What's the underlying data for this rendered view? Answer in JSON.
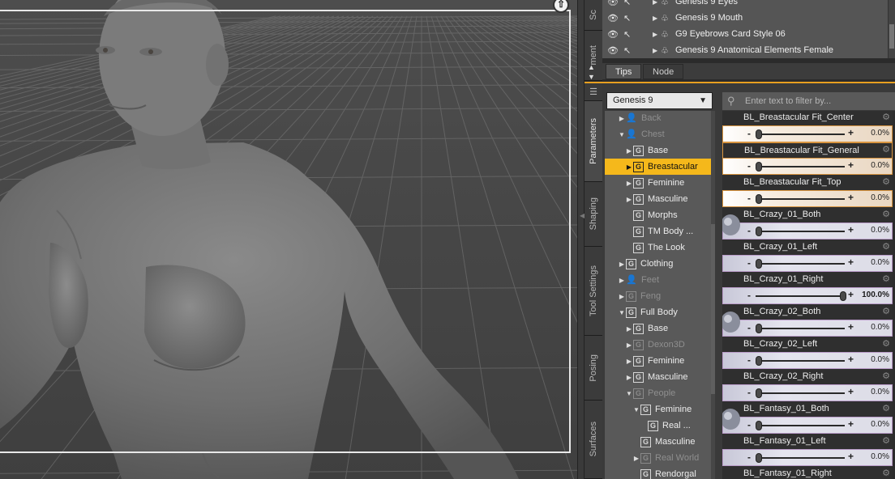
{
  "scene": {
    "rows": [
      {
        "label": "Genesis 9 Eyes"
      },
      {
        "label": "Genesis 9 Mouth"
      },
      {
        "label": "G9 Eyebrows Card Style 06"
      },
      {
        "label": "Genesis 9 Anatomical Elements Female"
      }
    ]
  },
  "tabs": {
    "vertical": [
      "Sc",
      "ment",
      "Parameters",
      "Shaping",
      "Tool Settings",
      "Posing",
      "Surfaces"
    ],
    "top": [
      "Tips",
      "Node"
    ]
  },
  "figure_select": {
    "value": "Genesis 9"
  },
  "filter": {
    "placeholder": "Enter text to filter by..."
  },
  "tree": [
    {
      "label": "Back",
      "icon": "person-icon",
      "dim": true,
      "arrow": "right",
      "indent": 1
    },
    {
      "label": "Chest",
      "icon": "person-icon",
      "dim": true,
      "arrow": "down",
      "indent": 1
    },
    {
      "label": "Base",
      "icon": "group-icon",
      "dim": false,
      "arrow": "right",
      "indent": 2
    },
    {
      "label": "Breastacular",
      "icon": "group-icon",
      "dim": false,
      "arrow": "right",
      "indent": 2,
      "selected": true
    },
    {
      "label": "Feminine",
      "icon": "group-icon",
      "dim": false,
      "arrow": "right",
      "indent": 2
    },
    {
      "label": "Masculine",
      "icon": "group-icon",
      "dim": false,
      "arrow": "right",
      "indent": 2
    },
    {
      "label": "Morphs",
      "icon": "group-icon",
      "dim": false,
      "arrow": "",
      "indent": 2
    },
    {
      "label": "TM Body ...",
      "icon": "group-icon",
      "dim": false,
      "arrow": "",
      "indent": 2
    },
    {
      "label": "The Look",
      "icon": "group-icon",
      "dim": false,
      "arrow": "",
      "indent": 2
    },
    {
      "label": "Clothing",
      "icon": "group-icon",
      "dim": false,
      "arrow": "right",
      "indent": 1
    },
    {
      "label": "Feet",
      "icon": "person-icon",
      "dim": true,
      "arrow": "right",
      "indent": 1
    },
    {
      "label": "Feng",
      "icon": "group-icon",
      "dim": true,
      "arrow": "right",
      "indent": 1
    },
    {
      "label": "Full Body",
      "icon": "group-icon",
      "dim": false,
      "arrow": "down",
      "indent": 1
    },
    {
      "label": "Base",
      "icon": "group-icon",
      "dim": false,
      "arrow": "right",
      "indent": 2
    },
    {
      "label": "Dexon3D",
      "icon": "group-icon",
      "dim": true,
      "arrow": "right",
      "indent": 2
    },
    {
      "label": "Feminine",
      "icon": "group-icon",
      "dim": false,
      "arrow": "right",
      "indent": 2
    },
    {
      "label": "Masculine",
      "icon": "group-icon",
      "dim": false,
      "arrow": "right",
      "indent": 2
    },
    {
      "label": "People",
      "icon": "group-icon",
      "dim": true,
      "arrow": "down",
      "indent": 2
    },
    {
      "label": "Feminine",
      "icon": "group-icon",
      "dim": false,
      "arrow": "down",
      "indent": 3
    },
    {
      "label": "Real ...",
      "icon": "group-icon",
      "dim": false,
      "arrow": "",
      "indent": 4
    },
    {
      "label": "Masculine",
      "icon": "group-icon",
      "dim": false,
      "arrow": "",
      "indent": 3
    },
    {
      "label": "Real World",
      "icon": "group-icon",
      "dim": true,
      "arrow": "right",
      "indent": 3
    },
    {
      "label": "Rendorgal",
      "icon": "group-icon",
      "dim": false,
      "arrow": "",
      "indent": 3
    }
  ],
  "properties": [
    {
      "name": "BL_Breastacular Fit_Center",
      "value": "0.0%",
      "fill": 0.0,
      "style": "orange",
      "highlight": false
    },
    {
      "name": "BL_Breastacular Fit_General",
      "value": "0.0%",
      "fill": 0.0,
      "style": "orange",
      "highlight": true
    },
    {
      "name": "BL_Breastacular Fit_Top",
      "value": "0.0%",
      "fill": 0.0,
      "style": "orange",
      "highlight": false
    },
    {
      "name": "BL_Crazy_01_Both",
      "value": "0.0%",
      "fill": 0.0,
      "style": "purple",
      "highlight": false
    },
    {
      "name": "BL_Crazy_01_Left",
      "value": "0.0%",
      "fill": 0.0,
      "style": "purple",
      "highlight": false
    },
    {
      "name": "BL_Crazy_01_Right",
      "value": "100.0%",
      "fill": 1.0,
      "style": "purple",
      "highlight": false
    },
    {
      "name": "BL_Crazy_02_Both",
      "value": "0.0%",
      "fill": 0.0,
      "style": "purple",
      "highlight": false
    },
    {
      "name": "BL_Crazy_02_Left",
      "value": "0.0%",
      "fill": 0.0,
      "style": "purple",
      "highlight": false
    },
    {
      "name": "BL_Crazy_02_Right",
      "value": "0.0%",
      "fill": 0.0,
      "style": "purple",
      "highlight": false
    },
    {
      "name": "BL_Fantasy_01_Both",
      "value": "0.0%",
      "fill": 0.0,
      "style": "purple",
      "highlight": false
    },
    {
      "name": "BL_Fantasy_01_Left",
      "value": "0.0%",
      "fill": 0.0,
      "style": "purple",
      "highlight": false
    },
    {
      "name": "BL_Fantasy_01_Right",
      "value": "0.0%",
      "fill": 0.0,
      "style": "purple",
      "highlight": false
    }
  ],
  "colors": {
    "accent": "#f5b81b",
    "orange_border": "#d99540",
    "purple_border": "#b99bc8"
  }
}
